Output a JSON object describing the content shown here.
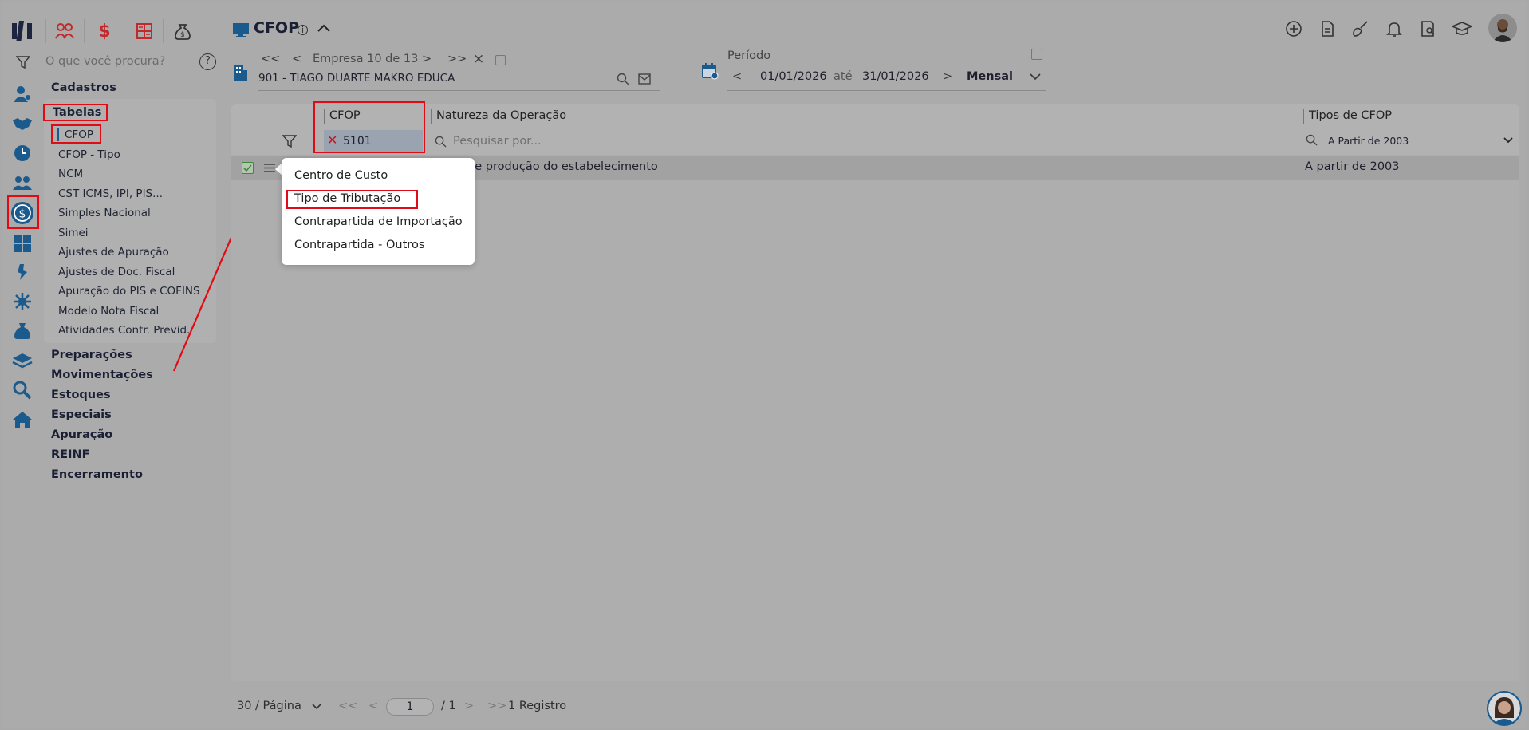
{
  "header": {
    "title": "CFOP",
    "top_icons": [
      "people-icon",
      "dollar-icon",
      "calculator-icon",
      "money-bag-icon"
    ],
    "right_icons": [
      "plus-circle-icon",
      "document-icon",
      "broom-icon",
      "bell-icon",
      "report-icon",
      "graduation-cap-icon",
      "user-avatar"
    ]
  },
  "sidebar": {
    "search_placeholder": "O que você procura?",
    "sections": {
      "cadastros": "Cadastros",
      "tabelas": "Tabelas",
      "preparacoes": "Preparações",
      "movimentacoes": "Movimentações",
      "estoques": "Estoques",
      "especiais": "Especiais",
      "apuracao": "Apuração",
      "reinf": "REINF",
      "encerramento": "Encerramento"
    },
    "tabelas_items": [
      "CFOP",
      "CFOP - Tipo",
      "NCM",
      "CST ICMS, IPI, PIS...",
      "Simples Nacional",
      "Simei",
      "Ajustes de Apuração",
      "Ajustes de Doc. Fiscal",
      "Apuração do PIS e COFINS",
      "Modelo Nota Fiscal",
      "Atividades Contr. Previd."
    ]
  },
  "company": {
    "nav_first": "<<",
    "nav_prev": "<",
    "label": "Empresa 10 de 13",
    "nav_next": ">",
    "nav_last": ">>",
    "close": "×",
    "name": "901 - TIAGO DUARTE MAKRO EDUCA"
  },
  "period": {
    "label": "Período",
    "start": "01/01/2026",
    "until": "até",
    "end": "31/01/2026",
    "mode": "Mensal"
  },
  "table": {
    "columns": {
      "cfop": "CFOP",
      "natureza": "Natureza da Operação",
      "tipos": "Tipos de CFOP"
    },
    "filters": {
      "cfop_value": "5101",
      "natureza_placeholder": "Pesquisar por...",
      "tipos_value": "A Partir de 2003"
    },
    "rows": [
      {
        "natureza": "de produção do estabelecimento",
        "tipo": "A partir de 2003"
      }
    ]
  },
  "context_menu": {
    "items": [
      "Centro de Custo",
      "Tipo de Tributação",
      "Contrapartida de Importação",
      "Contrapartida - Outros"
    ]
  },
  "footer": {
    "per_page": "30 / Página",
    "first": "<<",
    "prev": "<",
    "page": "1",
    "total_pages": "/ 1",
    "next": ">",
    "last": ">>",
    "records": "1 Registro"
  }
}
